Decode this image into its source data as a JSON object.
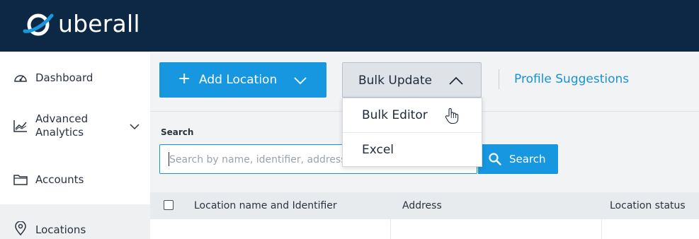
{
  "brand": {
    "name": "uberall",
    "bar_color": "#0d2845",
    "accent": "#1797e0"
  },
  "sidebar": {
    "items": [
      {
        "label": "Dashboard",
        "icon": "gauge-icon"
      },
      {
        "label": "Advanced\nAnalytics",
        "icon": "analytics-chart-icon"
      },
      {
        "label": "Accounts",
        "icon": "folder-icon"
      },
      {
        "label": "Locations",
        "icon": "location-pin-icon"
      }
    ]
  },
  "toolbar": {
    "add_location": "Add Location",
    "bulk_update": "Bulk Update",
    "profile_suggestions": "Profile Suggestions"
  },
  "bulk_menu": {
    "items": [
      "Bulk Editor",
      "Excel"
    ]
  },
  "search": {
    "label": "Search",
    "placeholder": "Search by name, identifier, address",
    "button": "Search"
  },
  "table": {
    "columns": [
      "Location name and Identifier",
      "Address",
      "Location status"
    ]
  }
}
